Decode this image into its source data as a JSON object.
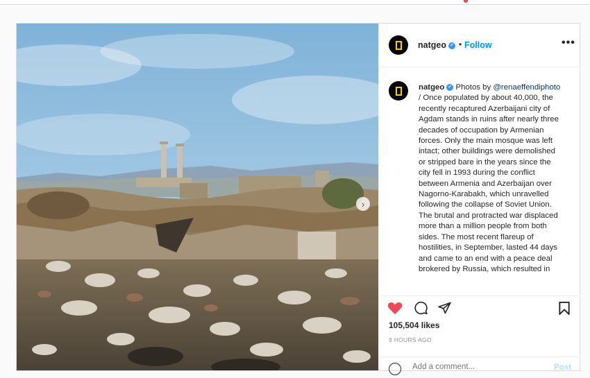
{
  "colors": {
    "accent": "#0095f6",
    "like_red": "#ed4956",
    "verified": "#3897f0",
    "brand_yellow": "#ffce00"
  },
  "header": {
    "username": "natgeo",
    "separator": "•",
    "follow_label": "Follow",
    "more_icon": "ellipsis-icon"
  },
  "caption": {
    "username": "natgeo",
    "intro": " Photos by ",
    "mention": "@renaeffendiphoto",
    "text": " / Once populated by about 40,000, the recently recaptured Azerbaijani city of Agdam stands in ruins after nearly three decades of occupation by Armenian forces. Only the main mosque was left intact; other buildings were demolished or stripped bare in the years since the city fell in 1993 during the conflict between Armenia and Azerbaijan over Nagorno-Karabakh, which unravelled following the collapse of Soviet Union. The brutal and protracted war displaced more than a million people from both sides. The most recent flareup of hostilities, in September, lasted 44 days and came to an end with a peace deal brokered by Russia, which resulted in"
  },
  "stats": {
    "likes": "105,504 likes",
    "time": "9 HOURS AGO"
  },
  "comment": {
    "placeholder": "Add a comment...",
    "post_label": "Post"
  },
  "icons": {
    "like": "heart-icon",
    "comment": "comment-icon",
    "share": "share-icon",
    "save": "bookmark-icon",
    "next": "chevron-right-icon"
  }
}
